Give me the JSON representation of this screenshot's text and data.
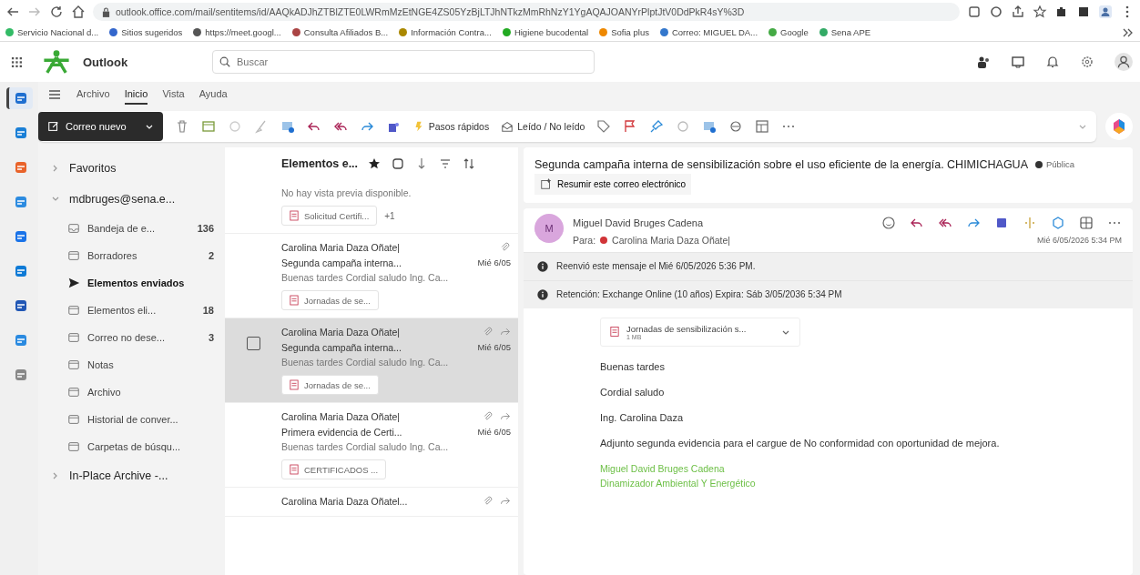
{
  "browser": {
    "url": "outlook.office.com/mail/sentitems/id/AAQkADJhZTBlZTE0LWRmMzEtNGE4ZS05YzBjLTJhNTkzMmRhNzY1YgAQAJOANYrPlptJtV0DdPkR4sY%3D",
    "bookmarks": [
      "Servicio Nacional d...",
      "Sitios sugeridos",
      "https://meet.googl...",
      "Consulta Afiliados B...",
      "Información Contra...",
      "Higiene bucodental",
      "Sofia plus",
      "Correo: MIGUEL DA...",
      "Google",
      "Sena APE"
    ]
  },
  "app": {
    "name": "Outlook",
    "search_placeholder": "Buscar"
  },
  "rail": [
    {
      "selected": true
    },
    {
      "selected": false
    },
    {
      "selected": false
    },
    {
      "selected": false
    },
    {
      "selected": false
    },
    {
      "selected": false
    },
    {
      "selected": false
    },
    {
      "selected": false
    },
    {
      "selected": false
    }
  ],
  "ribbon_tabs": [
    {
      "label": "Archivo",
      "selected": false
    },
    {
      "label": "Inicio",
      "selected": true
    },
    {
      "label": "Vista",
      "selected": false
    },
    {
      "label": "Ayuda",
      "selected": false
    }
  ],
  "toolbar": {
    "new_mail": "Correo nuevo",
    "quick_steps": "Pasos rápidos",
    "read_unread": "Leído / No leído"
  },
  "folders": {
    "favorites": {
      "label": "Favoritos",
      "expanded": false
    },
    "account": {
      "label": "mdbruges@sena.e...",
      "expanded": true,
      "children": [
        {
          "label": "Bandeja de e...",
          "count": "136",
          "selected": false
        },
        {
          "label": "Borradores",
          "count": "2",
          "selected": false
        },
        {
          "label": "Elementos enviados",
          "selected": true
        },
        {
          "label": "Elementos eli...",
          "count": "18",
          "selected": false
        },
        {
          "label": "Correo no dese...",
          "count": "3",
          "selected": false
        },
        {
          "label": "Notas",
          "selected": false
        },
        {
          "label": "Archivo",
          "selected": false
        },
        {
          "label": "Historial de conver...",
          "selected": false
        },
        {
          "label": "Carpetas de búsqu...",
          "selected": false
        }
      ]
    },
    "archive": {
      "label": "In-Place Archive -...",
      "expanded": false
    }
  },
  "message_list": {
    "title": "Elementos e...",
    "messages": [
      {
        "preview": "No hay vista previa disponible.",
        "attachment": "Solicitud Certifi...",
        "extra": "+1",
        "selected": false
      },
      {
        "sender": "Carolina Maria Daza Oñate|",
        "subject": "Segunda campaña interna...",
        "date": "Mié 6/05",
        "preview": "Buenas tardes Cordial saludo Ing. Ca...",
        "attachment": "Jornadas de se...",
        "has_attachment": true,
        "forwarded": false,
        "selected": false
      },
      {
        "sender": "Carolina Maria Daza Oñate|",
        "subject": "Segunda campaña interna...",
        "date": "Mié 6/05",
        "preview": "Buenas tardes Cordial saludo Ing. Ca...",
        "attachment": "Jornadas de se...",
        "has_attachment": true,
        "forwarded": true,
        "selected": true
      },
      {
        "sender": "Carolina Maria Daza Oñate|",
        "subject": "Primera evidencia de Certi...",
        "date": "Mié 6/05",
        "preview": "Buenas tardes Cordial saludo Ing. Ca...",
        "attachment": "CERTIFICADOS ...",
        "has_attachment": true,
        "forwarded": true,
        "selected": false
      },
      {
        "sender": "Carolina Maria Daza Oñatel...",
        "has_attachment": true,
        "forwarded": true,
        "selected": false
      }
    ]
  },
  "reading": {
    "subject": "Segunda campaña interna de sensibilización sobre el uso eficiente de la energía. CHIMICHAGUA",
    "sensitivity": "Pública",
    "summarize": "Resumir este correo electrónico",
    "from": "Miguel David Bruges Cadena",
    "avatar": "M",
    "to_label": "Para:",
    "to": "Carolina Maria Daza Oñate|",
    "to_busy": true,
    "date": "Mié 6/05/2026 5:34 PM",
    "notices": [
      "Reenvió este mensaje el Mié 6/05/2026 5:36 PM.",
      "Retención: Exchange Online (10 años) Expira: Sáb 3/05/2036 5:34 PM"
    ],
    "attachment": {
      "name": "Jornadas de sensibilización s...",
      "size": "1 MB"
    },
    "body": [
      "Buenas tardes",
      "Cordial saludo",
      "Ing. Carolina Daza",
      "Adjunto segunda evidencia para el cargue de No conformidad con oportunidad de mejora."
    ],
    "signature": [
      "Miguel David Bruges Cadena",
      "Dinamizador Ambiental Y Energético"
    ]
  }
}
